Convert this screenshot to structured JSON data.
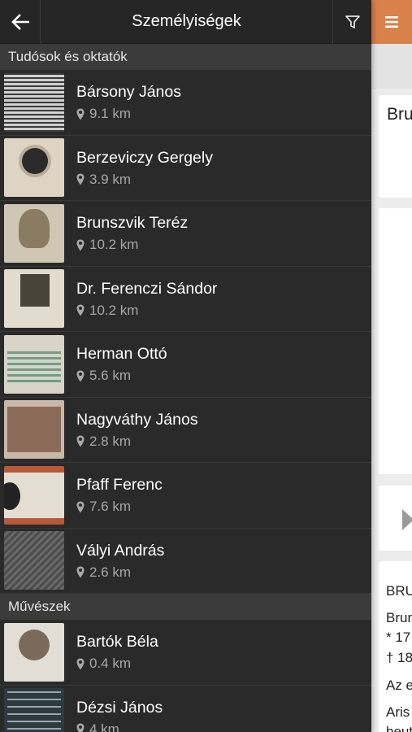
{
  "header": {
    "title": "Személyiségek",
    "back_icon": "arrow-left-icon",
    "filter_icon": "filter-icon",
    "menu_icon": "hamburger-menu-icon"
  },
  "sections": [
    {
      "title": "Tudósok és oktatók",
      "items": [
        {
          "name": "Bársony János",
          "distance": "9.1 km"
        },
        {
          "name": "Berzeviczy Gergely",
          "distance": "3.9 km"
        },
        {
          "name": "Brunszvik Teréz",
          "distance": "10.2 km"
        },
        {
          "name": "Dr. Ferenczi Sándor",
          "distance": "10.2 km"
        },
        {
          "name": "Herman Ottó",
          "distance": "5.6 km"
        },
        {
          "name": "Nagyváthy János",
          "distance": "2.8 km"
        },
        {
          "name": "Pfaff Ferenc",
          "distance": "7.6 km"
        },
        {
          "name": "Vályi András",
          "distance": "2.6 km"
        }
      ]
    },
    {
      "title": "Művészek",
      "items": [
        {
          "name": "Bartók Béla",
          "distance": "0.4 km"
        },
        {
          "name": "Dézsi János",
          "distance": "4 km"
        }
      ]
    }
  ],
  "detail": {
    "title": "Bru",
    "text_lines": [
      "BRU",
      "Brun",
      "* 17",
      "† 18",
      "Az e",
      "Aris",
      "beut"
    ]
  },
  "colors": {
    "drawer_bg": "#2a2a2a",
    "section_bg": "#3b3b3b",
    "accent": "#d9814a"
  }
}
